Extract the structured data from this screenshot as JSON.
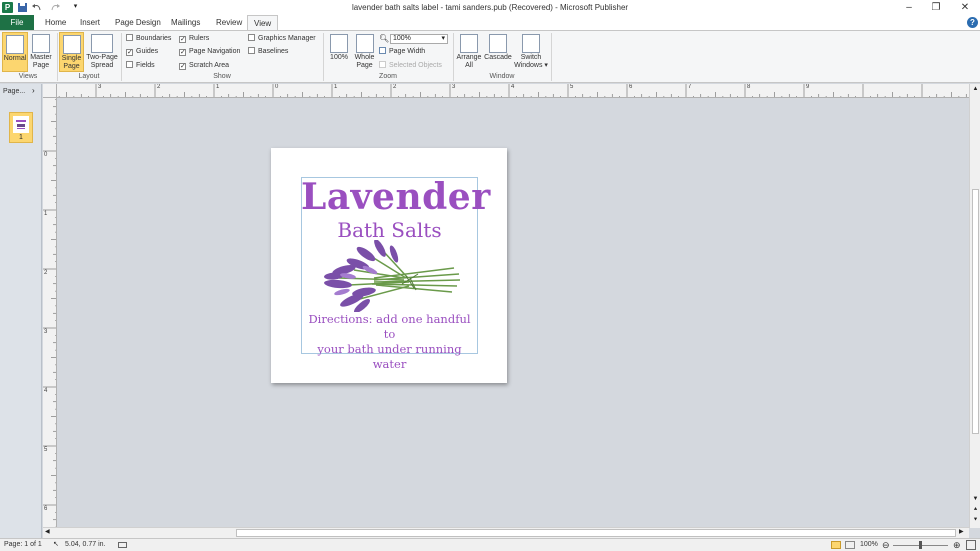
{
  "window": {
    "title": "lavender bath salts label - tami sanders.pub (Recovered)  -  Microsoft Publisher",
    "app_logo": "P",
    "controls": [
      "minimize-icon",
      "restore-icon",
      "close-icon"
    ]
  },
  "tabs": [
    {
      "label": "File"
    },
    {
      "label": "Home"
    },
    {
      "label": "Insert"
    },
    {
      "label": "Page Design"
    },
    {
      "label": "Mailings"
    },
    {
      "label": "Review"
    },
    {
      "label": "View"
    }
  ],
  "ribbon": {
    "views": {
      "group_label": "Views",
      "normal": "Normal",
      "master_page_1": "Master",
      "master_page_2": "Page"
    },
    "layout": {
      "group_label": "Layout",
      "single_page_1": "Single",
      "single_page_2": "Page",
      "two_page_1": "Two-Page",
      "two_page_2": "Spread"
    },
    "show": {
      "group_label": "Show",
      "boundaries": "Boundaries",
      "guides": "Guides",
      "fields": "Fields",
      "rulers": "Rulers",
      "page_navigation": "Page Navigation",
      "scratch_area": "Scratch Area",
      "graphics_manager": "Graphics Manager",
      "baselines": "Baselines",
      "checked": {
        "boundaries": false,
        "guides": true,
        "fields": false,
        "rulers": true,
        "page_navigation": true,
        "scratch_area": true,
        "graphics_manager": false,
        "baselines": false
      }
    },
    "zoom": {
      "group_label": "Zoom",
      "hundred": "100%",
      "whole_page_1": "Whole",
      "whole_page_2": "Page",
      "combo_value": "100%",
      "page_width": "Page Width",
      "selected_objects": "Selected Objects"
    },
    "window": {
      "group_label": "Window",
      "arrange_1": "Arrange",
      "arrange_2": "All",
      "cascade": "Cascade",
      "switch_1": "Switch",
      "switch_2": "Windows ▾"
    }
  },
  "nav_pane": {
    "header": "Page...",
    "page_number": "1"
  },
  "rulers": {
    "h_labels": [
      "3",
      "2",
      "1",
      "0",
      "1",
      "2",
      "3",
      "4",
      "5",
      "6",
      "7",
      "8",
      "9"
    ],
    "v_labels": [
      "0",
      "1",
      "2",
      "3",
      "4",
      "5",
      "6"
    ]
  },
  "document": {
    "title": "Lavender",
    "subtitle": "Bath Salts",
    "directions_line1": "Directions: add one handful to",
    "directions_line2": "your bath under running water"
  },
  "status": {
    "page": "Page: 1 of 1",
    "position": "5.04, 0.77 in.",
    "zoom": "100%"
  },
  "colors": {
    "accent_purple": "#9a4fc0",
    "file_tab": "#1e7145",
    "active_button": "#fcd66f"
  }
}
